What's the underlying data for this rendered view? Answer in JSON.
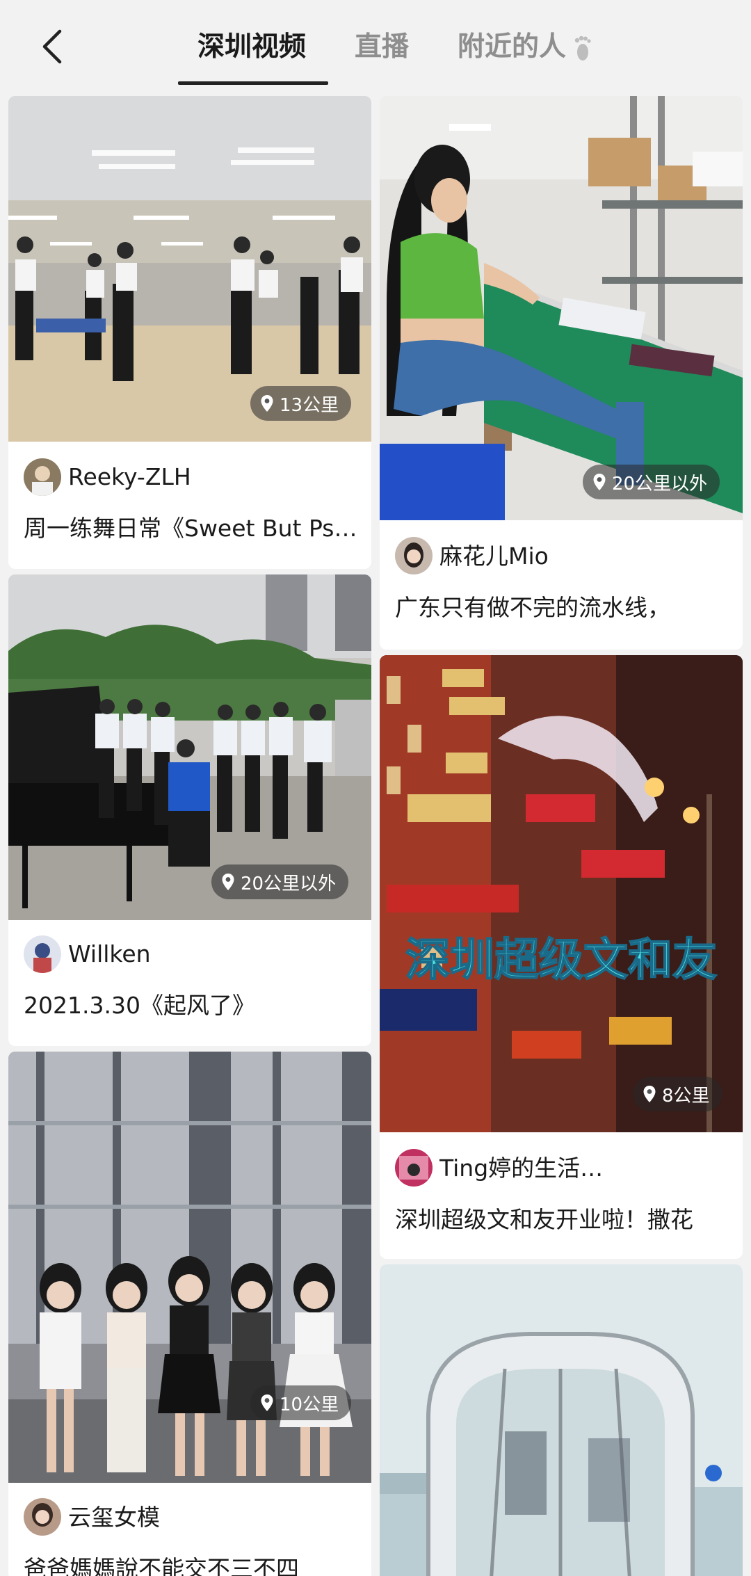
{
  "header": {
    "back_icon": "chevron-left-icon",
    "tabs": [
      {
        "label": "深圳视频",
        "active": true
      },
      {
        "label": "直播",
        "active": false
      },
      {
        "label": "附近的人",
        "active": false
      }
    ],
    "nearby_icon": "footprint-icon"
  },
  "feed": {
    "items": [
      {
        "author": "Reeky-ZLH",
        "caption": "周一练舞日常《Sweet But Psycho》",
        "distance": "13公里",
        "scene": "dance-class"
      },
      {
        "author": "麻花儿Mio",
        "caption": "广东只有做不完的流水线，",
        "distance": "20公里以外",
        "scene": "factory-worker"
      },
      {
        "author": "Willken",
        "caption": "2021.3.30《起风了》",
        "distance": "20公里以外",
        "scene": "piano-choir"
      },
      {
        "author": "Ting婷的生活…",
        "caption": "深圳超级文和友开业啦！撒花",
        "distance": "8公里",
        "scene": "night-street",
        "overlay_text": "深圳超级文和友"
      },
      {
        "author": "云玺女模",
        "caption": "爸爸媽媽說不能交不三不四",
        "distance": "10公里",
        "scene": "girls-dance"
      },
      {
        "author": "",
        "caption": "",
        "distance": "",
        "scene": "ferris-wheel"
      }
    ]
  },
  "colors": {
    "background": "#f2f2f2",
    "card": "#ffffff",
    "badge": "rgba(40,40,40,0.55)"
  }
}
